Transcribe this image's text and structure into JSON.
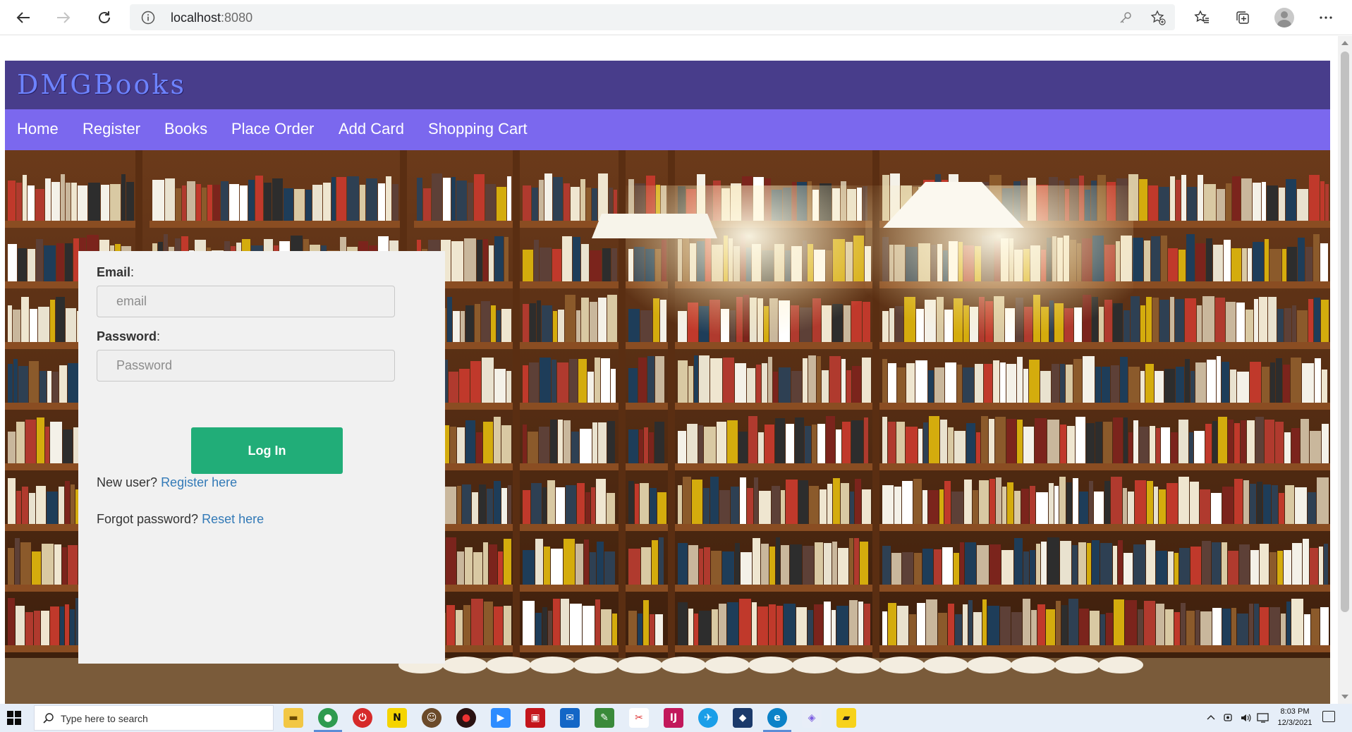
{
  "browser": {
    "url_host": "localhost",
    "url_port": ":8080"
  },
  "site": {
    "title": "DMGBooks",
    "nav": [
      "Home",
      "Register",
      "Books",
      "Place Order",
      "Add Card",
      "Shopping Cart"
    ]
  },
  "login": {
    "email_label": "Email",
    "email_placeholder": "email",
    "password_label": "Password",
    "password_placeholder": "Password",
    "submit_label": "Log In",
    "new_user_text": "New user?",
    "register_link": "Register here",
    "forgot_text": "Forgot password?",
    "reset_link": "Reset here"
  },
  "taskbar": {
    "search_placeholder": "Type here to search",
    "time": "8:03 PM",
    "date": "12/3/2021"
  },
  "colors": {
    "header": "#483d8b",
    "nav": "#7b68ee",
    "title": "#6d83ff",
    "login_button": "#21ad78",
    "link": "#337ab7"
  }
}
